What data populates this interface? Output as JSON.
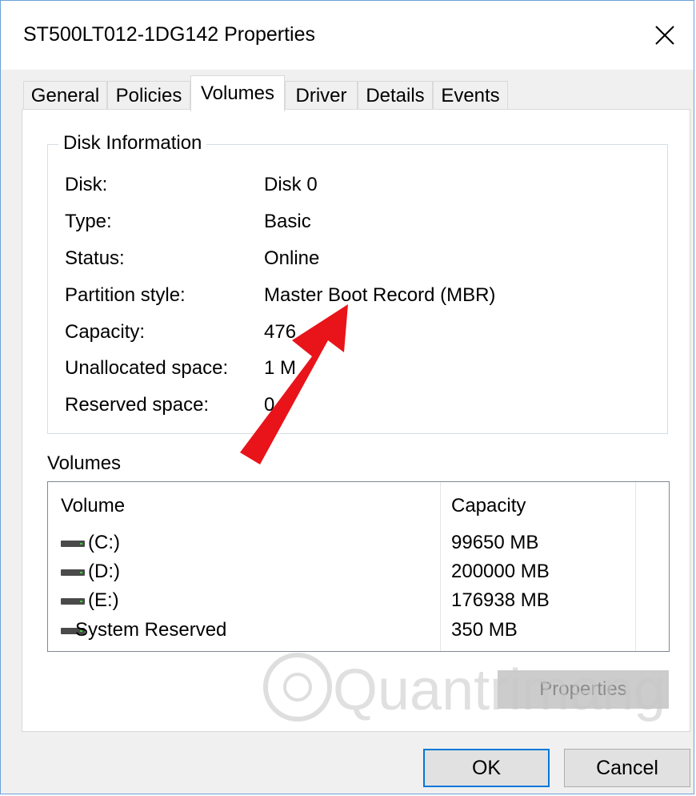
{
  "window": {
    "title": "ST500LT012-1DG142 Properties",
    "close_icon": "close-icon"
  },
  "tabs": [
    "General",
    "Policies",
    "Volumes",
    "Driver",
    "Details",
    "Events"
  ],
  "active_tab": "Volumes",
  "disk_info": {
    "title": "Disk Information",
    "rows": [
      {
        "label": "Disk:",
        "value": "Disk 0"
      },
      {
        "label": "Type:",
        "value": "Basic"
      },
      {
        "label": "Status:",
        "value": "Online"
      },
      {
        "label": "Partition style:",
        "value": "Master Boot Record (MBR)"
      },
      {
        "label": "Capacity:",
        "value": "476"
      },
      {
        "label": "Unallocated space:",
        "value": "1 M"
      },
      {
        "label": "Reserved space:",
        "value": "0"
      }
    ]
  },
  "volumes": {
    "heading": "Volumes",
    "columns": [
      "Volume",
      "Capacity"
    ],
    "rows": [
      {
        "name": "(C:)",
        "capacity": "99650 MB"
      },
      {
        "name": "(D:)",
        "capacity": "200000 MB"
      },
      {
        "name": "(E:)",
        "capacity": "176938 MB"
      },
      {
        "name": "System Reserved",
        "capacity": "350 MB"
      }
    ],
    "properties_button": "Properties"
  },
  "buttons": {
    "ok": "OK",
    "cancel": "Cancel"
  },
  "colors": {
    "accent": "#0078d7",
    "arrow": "#e8141a",
    "window_border": "#6fa0d8"
  },
  "watermark_text": "Quantrimang"
}
